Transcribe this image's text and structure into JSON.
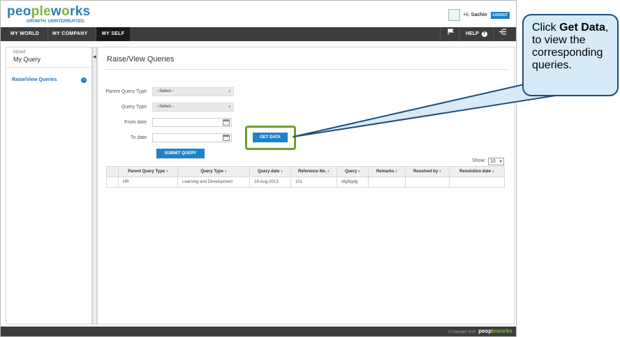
{
  "header": {
    "logo": {
      "part1": "peo",
      "part2": "ple",
      "part3": "w",
      "part4": "o",
      "part5": "rks",
      "tagline": "GROWTH. UNINTERRUPTED."
    },
    "greeting_prefix": "Hi, ",
    "user_name": "Sachin",
    "logout_label": "LOGOUT"
  },
  "nav": {
    "items": [
      {
        "label": "MY WORLD"
      },
      {
        "label": "MY COMPANY"
      },
      {
        "label": "MY SELF"
      }
    ],
    "help_label": "HELP"
  },
  "sidebar": {
    "section_small": "Myself",
    "section_title": "My Query",
    "link_label": "Raise/View Queries"
  },
  "main": {
    "page_title": "Raise/View Queries",
    "form": {
      "parent_query_type_label": "Parent Query Type",
      "parent_query_type_value": "--Select--",
      "query_type_label": "Query Type",
      "query_type_value": "--Select--",
      "from_date_label": "From date",
      "to_date_label": "To date",
      "get_data_label": "GET DATA",
      "submit_label": "SUBMIT QUERY"
    },
    "show_label": "Show:",
    "page_size": "10",
    "table": {
      "columns": [
        "",
        "Parent Query Type",
        "Query Type",
        "Query date",
        "Reference No.",
        "Query",
        "Remarks",
        "Resolved by",
        "Resolution date"
      ],
      "rows": [
        [
          "",
          "HR",
          "Learning and Development",
          "16-Aug-2013",
          "101",
          "dfgfdgdg",
          "",
          "",
          ""
        ]
      ]
    }
  },
  "footer": {
    "copyright": "© Copyright 2014",
    "logo_part1": "peop",
    "logo_part2": "leworks"
  },
  "callout": {
    "line1_prefix": "Click ",
    "line1_bold": "Get Data",
    "line1_suffix": ", to view the corresponding queries."
  },
  "colors": {
    "accent": "#1e82c8",
    "nav_bg": "#3d3d3d",
    "highlight_frame": "#6e9e2a",
    "callout_bg": "#d6eaf8",
    "callout_border": "#1f4e79"
  }
}
